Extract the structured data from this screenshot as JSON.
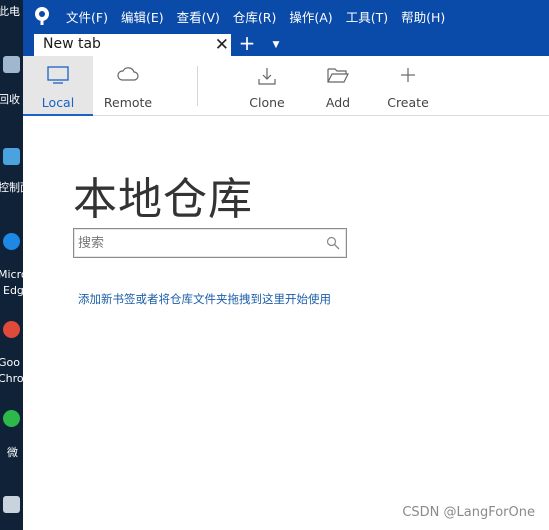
{
  "desktop": {
    "items": [
      {
        "label": "此电",
        "color": "#5aa0e0"
      },
      {
        "label": "回收",
        "color": "#9fb8cf"
      },
      {
        "label": "控制面",
        "color": "#4aa3df"
      },
      {
        "label": "Micro",
        "label2": "Edg",
        "color": "#1e88e5"
      },
      {
        "label": "Goo",
        "label2": "Chro",
        "color": "#e04a3a"
      },
      {
        "label": "微",
        "color": "#2db84c"
      }
    ]
  },
  "menubar": {
    "items": [
      "文件(F)",
      "编辑(E)",
      "查看(V)",
      "仓库(R)",
      "操作(A)",
      "工具(T)",
      "帮助(H)"
    ]
  },
  "tabs": {
    "current_title": "New tab",
    "close_glyph": "✕",
    "add_glyph": "+",
    "menu_glyph": "▼"
  },
  "toolbar": {
    "local": "Local",
    "remote": "Remote",
    "clone": "Clone",
    "add": "Add",
    "create": "Create"
  },
  "main": {
    "title": "本地仓库",
    "search_placeholder": "搜索",
    "hint": "添加新书签或者将仓库文件夹拖拽到这里开始使用"
  },
  "watermark": "CSDN @LangForOne",
  "colors": {
    "menubar": "#0a4aa8",
    "accent": "#1b62c4",
    "link": "#1b5ea8"
  }
}
